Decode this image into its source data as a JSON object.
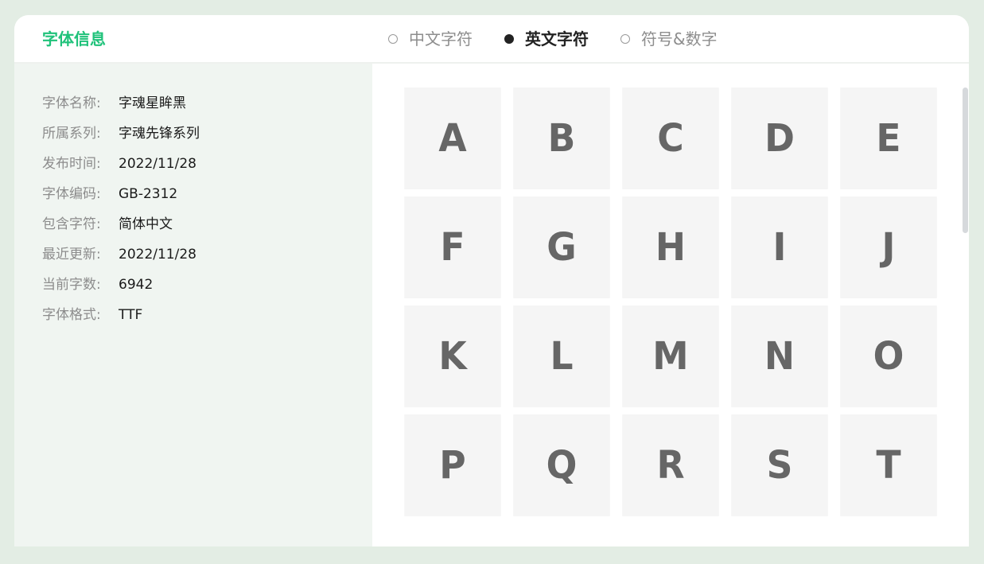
{
  "header": {
    "brand": "字体信息",
    "tabs": [
      {
        "label": "中文字符",
        "active": false
      },
      {
        "label": "英文字符",
        "active": true
      },
      {
        "label": "符号&数字",
        "active": false
      }
    ]
  },
  "info": [
    {
      "label": "字体名称:",
      "value": "字魂星眸黑"
    },
    {
      "label": "所属系列:",
      "value": "字魂先锋系列"
    },
    {
      "label": "发布时间:",
      "value": "2022/11/28"
    },
    {
      "label": "字体编码:",
      "value": "GB-2312"
    },
    {
      "label": "包含字符:",
      "value": "简体中文"
    },
    {
      "label": "最近更新:",
      "value": "2022/11/28"
    },
    {
      "label": "当前字数:",
      "value": "6942"
    },
    {
      "label": "字体格式:",
      "value": "TTF"
    }
  ],
  "glyphs": [
    "A",
    "B",
    "C",
    "D",
    "E",
    "F",
    "G",
    "H",
    "I",
    "J",
    "K",
    "L",
    "M",
    "N",
    "O",
    "P",
    "Q",
    "R",
    "S",
    "T"
  ],
  "colors": {
    "accent": "#1fc27a",
    "page_bg": "#e3ede4",
    "panel_bg": "#f0f5f1",
    "tile_bg": "#f5f5f5",
    "glyph": "#666666"
  }
}
